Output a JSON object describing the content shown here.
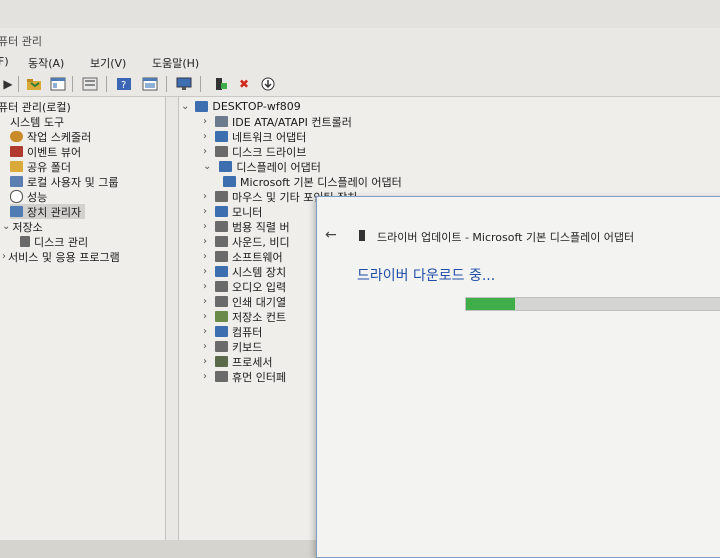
{
  "window": {
    "title": "퓨터 관리"
  },
  "menu": [
    "F)",
    "동작(A)",
    "보기(V)",
    "도움말(H)"
  ],
  "toolbar_icons": [
    "back-icon",
    "folder-icon",
    "console-icon",
    "export-icon",
    "help-icon",
    "view-icon",
    "monitor-icon",
    "update-driver-icon",
    "remove-icon",
    "download-icon"
  ],
  "left_tree": {
    "root": "퓨터 관리(로컬)",
    "items": [
      {
        "label": "시스템 도구",
        "level": 0,
        "expanded": true
      },
      {
        "label": "작업 스케줄러",
        "level": 1,
        "icon_color": "#c98a2a"
      },
      {
        "label": "이벤트 뷰어",
        "level": 1,
        "icon_color": "#b03a2e"
      },
      {
        "label": "공유 폴더",
        "level": 1,
        "icon_color": "#d9a93a"
      },
      {
        "label": "로컬 사용자 및 그룹",
        "level": 1,
        "icon_color": "#5a7fb0"
      },
      {
        "label": "성능",
        "level": 1,
        "icon_color": "#555555"
      },
      {
        "label": "장치 관리자",
        "level": 1,
        "icon_color": "#4f7db3",
        "selected": true
      },
      {
        "label": "저장소",
        "level": 0,
        "expanded": true
      },
      {
        "label": "디스크 관리",
        "level": 1,
        "icon_color": "#6a6a6a"
      },
      {
        "label": "서비스 및 응용 프로그램",
        "level": 0,
        "expanded": false
      }
    ]
  },
  "device_tree": {
    "root": "DESKTOP-wf809",
    "categories": [
      {
        "label": "IDE ATA/ATAPI 컨트롤러",
        "icon_color": "#6b7a8c"
      },
      {
        "label": "네트워크 어댑터",
        "icon_color": "#3d6fb0"
      },
      {
        "label": "디스크 드라이브",
        "icon_color": "#6a6a6a"
      },
      {
        "label": "디스플레이 어댑터",
        "icon_color": "#3d6fb0",
        "expanded": true
      },
      {
        "label": "Microsoft 기본 디스플레이 어댑터",
        "icon_color": "#3d6fb0",
        "child": true
      },
      {
        "label": "마우스 및 기타 포인팅 장치",
        "icon_color": "#6a6a6a"
      },
      {
        "label": "모니터",
        "icon_color": "#3d6fb0"
      },
      {
        "label": "범용 직렬 버",
        "icon_color": "#6a6a6a"
      },
      {
        "label": "사운드, 비디",
        "icon_color": "#6a6a6a"
      },
      {
        "label": "소프트웨어",
        "icon_color": "#6a6a6a"
      },
      {
        "label": "시스템 장치",
        "icon_color": "#3d6fb0"
      },
      {
        "label": "오디오 입력",
        "icon_color": "#6a6a6a"
      },
      {
        "label": "인쇄 대기열",
        "icon_color": "#6a6a6a"
      },
      {
        "label": "저장소 컨트",
        "icon_color": "#6a8a4a"
      },
      {
        "label": "컴퓨터",
        "icon_color": "#3d6fb0"
      },
      {
        "label": "키보드",
        "icon_color": "#6a6a6a"
      },
      {
        "label": "프로세서",
        "icon_color": "#5a6a4a"
      },
      {
        "label": "휴먼 인터페",
        "icon_color": "#6a6a6a"
      }
    ]
  },
  "dialog": {
    "title": "드라이버 업데이트 - Microsoft 기본 디스플레이 어댑터",
    "status": "드라이버 다운로드 중...",
    "progress": 0.18
  }
}
